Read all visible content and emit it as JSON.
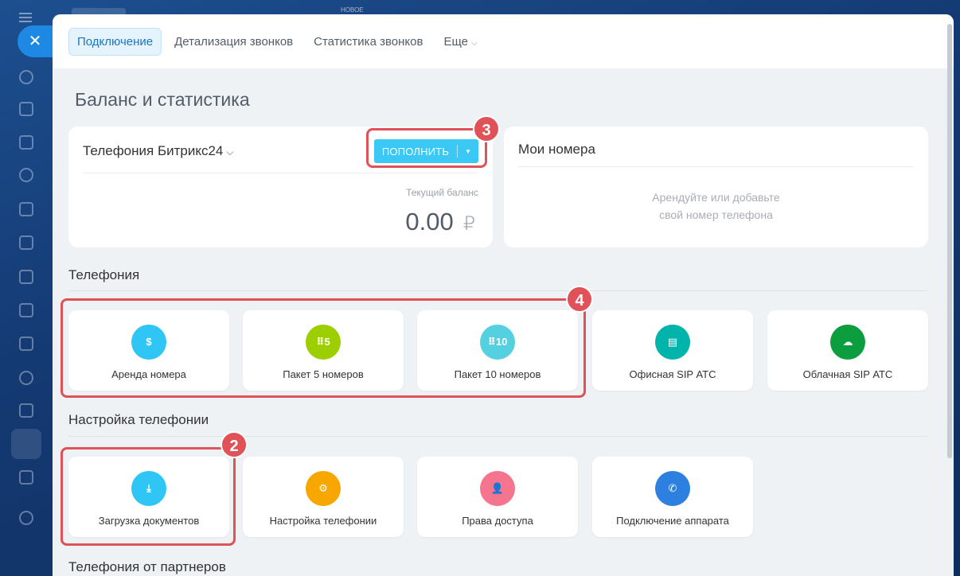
{
  "rail": {
    "close_glyph": "✕",
    "top_label": "НОВОЕ"
  },
  "tabs": [
    {
      "label": "Подключение",
      "active": true
    },
    {
      "label": "Детализация звонков"
    },
    {
      "label": "Статистика звонков"
    },
    {
      "label": "Еще"
    }
  ],
  "page_title": "Баланс и статистика",
  "balance": {
    "title": "Телефония Битрикс24",
    "topup_label": "ПОПОЛНИТЬ",
    "current_label": "Текущий баланс",
    "value": "0.00",
    "currency": "₽"
  },
  "my_numbers": {
    "title": "Мои номера",
    "hint_line1": "Арендуйте или добавьте",
    "hint_line2": "свой номер телефона"
  },
  "sections": {
    "telephony": "Телефония",
    "settings": "Настройка телефонии",
    "partners": "Телефония от партнеров"
  },
  "telephony_tiles": [
    {
      "label": "Аренда номера",
      "icon": "phone-dollar-icon",
      "color": "#2fc6f6",
      "glyph": "$"
    },
    {
      "label": "Пакет 5 номеров",
      "icon": "dialpad-5-icon",
      "color": "#9dcf00",
      "glyph": "⠿5"
    },
    {
      "label": "Пакет 10 номеров",
      "icon": "dialpad-10-icon",
      "color": "#55d0e0",
      "glyph": "⠿10"
    },
    {
      "label": "Офисная SIP АТС",
      "icon": "office-pbx-icon",
      "color": "#00b4ac",
      "glyph": "▤"
    },
    {
      "label": "Облачная SIP АТС",
      "icon": "cloud-pbx-icon",
      "color": "#0c9d3f",
      "glyph": "☁"
    }
  ],
  "settings_tiles": [
    {
      "label": "Загрузка документов",
      "icon": "document-upload-icon",
      "color": "#2fc6f6",
      "glyph": "⤓"
    },
    {
      "label": "Настройка телефонии",
      "icon": "gear-icon",
      "color": "#f7a700",
      "glyph": "⚙"
    },
    {
      "label": "Права доступа",
      "icon": "user-lock-icon",
      "color": "#f6758e",
      "glyph": "👤"
    },
    {
      "label": "Подключение аппарата",
      "icon": "phone-plug-icon",
      "color": "#2d7fe0",
      "glyph": "✆"
    }
  ],
  "badges": {
    "b2": "2",
    "b3": "3",
    "b4": "4"
  },
  "colors": {
    "accent": "#3bc8f5",
    "highlight": "#e05158"
  }
}
